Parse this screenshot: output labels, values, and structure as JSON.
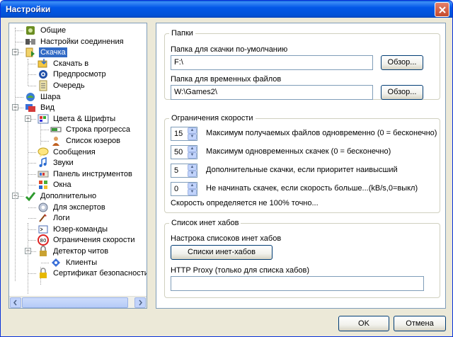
{
  "window": {
    "title": "Настройки"
  },
  "tree": [
    {
      "label": "Общие",
      "icon": "general-icon",
      "level": 1
    },
    {
      "label": "Настройки соединения",
      "icon": "connection-icon",
      "level": 1
    },
    {
      "label": "Скачка",
      "icon": "download-icon",
      "level": 1,
      "selected": true
    },
    {
      "label": "Скачать в",
      "icon": "download-to-icon",
      "level": 2
    },
    {
      "label": "Предпросмотр",
      "icon": "preview-icon",
      "level": 2
    },
    {
      "label": "Очередь",
      "icon": "queue-icon",
      "level": 2
    },
    {
      "label": "Шара",
      "icon": "share-icon",
      "level": 1
    },
    {
      "label": "Вид",
      "icon": "view-icon",
      "level": 1
    },
    {
      "label": "Цвета & Шрифты",
      "icon": "colors-fonts-icon",
      "level": 2
    },
    {
      "label": "Строка прогресса",
      "icon": "progress-bar-icon",
      "level": 3
    },
    {
      "label": "Список юзеров",
      "icon": "user-list-icon",
      "level": 3
    },
    {
      "label": "Сообщения",
      "icon": "messages-icon",
      "level": 2
    },
    {
      "label": "Звуки",
      "icon": "sounds-icon",
      "level": 2
    },
    {
      "label": "Панель инструментов",
      "icon": "toolbar-icon",
      "level": 2
    },
    {
      "label": "Окна",
      "icon": "windows-icon",
      "level": 2
    },
    {
      "label": "Дополнительно",
      "icon": "advanced-icon",
      "level": 1
    },
    {
      "label": "Для экспертов",
      "icon": "experts-icon",
      "level": 2
    },
    {
      "label": "Логи",
      "icon": "logs-icon",
      "level": 2
    },
    {
      "label": "Юзер-команды",
      "icon": "user-commands-icon",
      "level": 2
    },
    {
      "label": "Ограничения скорости",
      "icon": "speed-limit-icon",
      "level": 2
    },
    {
      "label": "Детектор читов",
      "icon": "cheat-detector-icon",
      "level": 2
    },
    {
      "label": "Клиенты",
      "icon": "clients-icon",
      "level": 3
    },
    {
      "label": "Сертификат безопасности",
      "icon": "certificate-icon",
      "level": 2
    }
  ],
  "folders": {
    "legend": "Папки",
    "download_label": "Папка для скачки по-умолчанию",
    "download_value": "F:\\",
    "temp_label": "Папка для временных файлов",
    "temp_value": "W:\\Games2\\",
    "browse_label": "Обзор..."
  },
  "speed": {
    "legend": "Ограничения скорости",
    "rows": [
      {
        "value": "15",
        "label": "Максимум получаемых файлов одновременно (0 = бесконечно)"
      },
      {
        "value": "50",
        "label": "Максимум одновременных скачек (0 = бесконечно)"
      },
      {
        "value": "5",
        "label": "Дополнительные скачки, если приоритет наивысший"
      },
      {
        "value": "0",
        "label": "Не начинать скачек, если скорость больше...(kB/s,0=выкл)"
      }
    ],
    "note": "Скорость определяется не 100% точно..."
  },
  "hubs": {
    "legend": "Список инет хабов",
    "config_label": "Настрока списоков инет хабов",
    "button_label": "Списки инет-хабов",
    "proxy_label": "HTTP Proxy (только для списка хабов)",
    "proxy_value": ""
  },
  "footer": {
    "ok_label": "OK",
    "cancel_label": "Отмена"
  }
}
